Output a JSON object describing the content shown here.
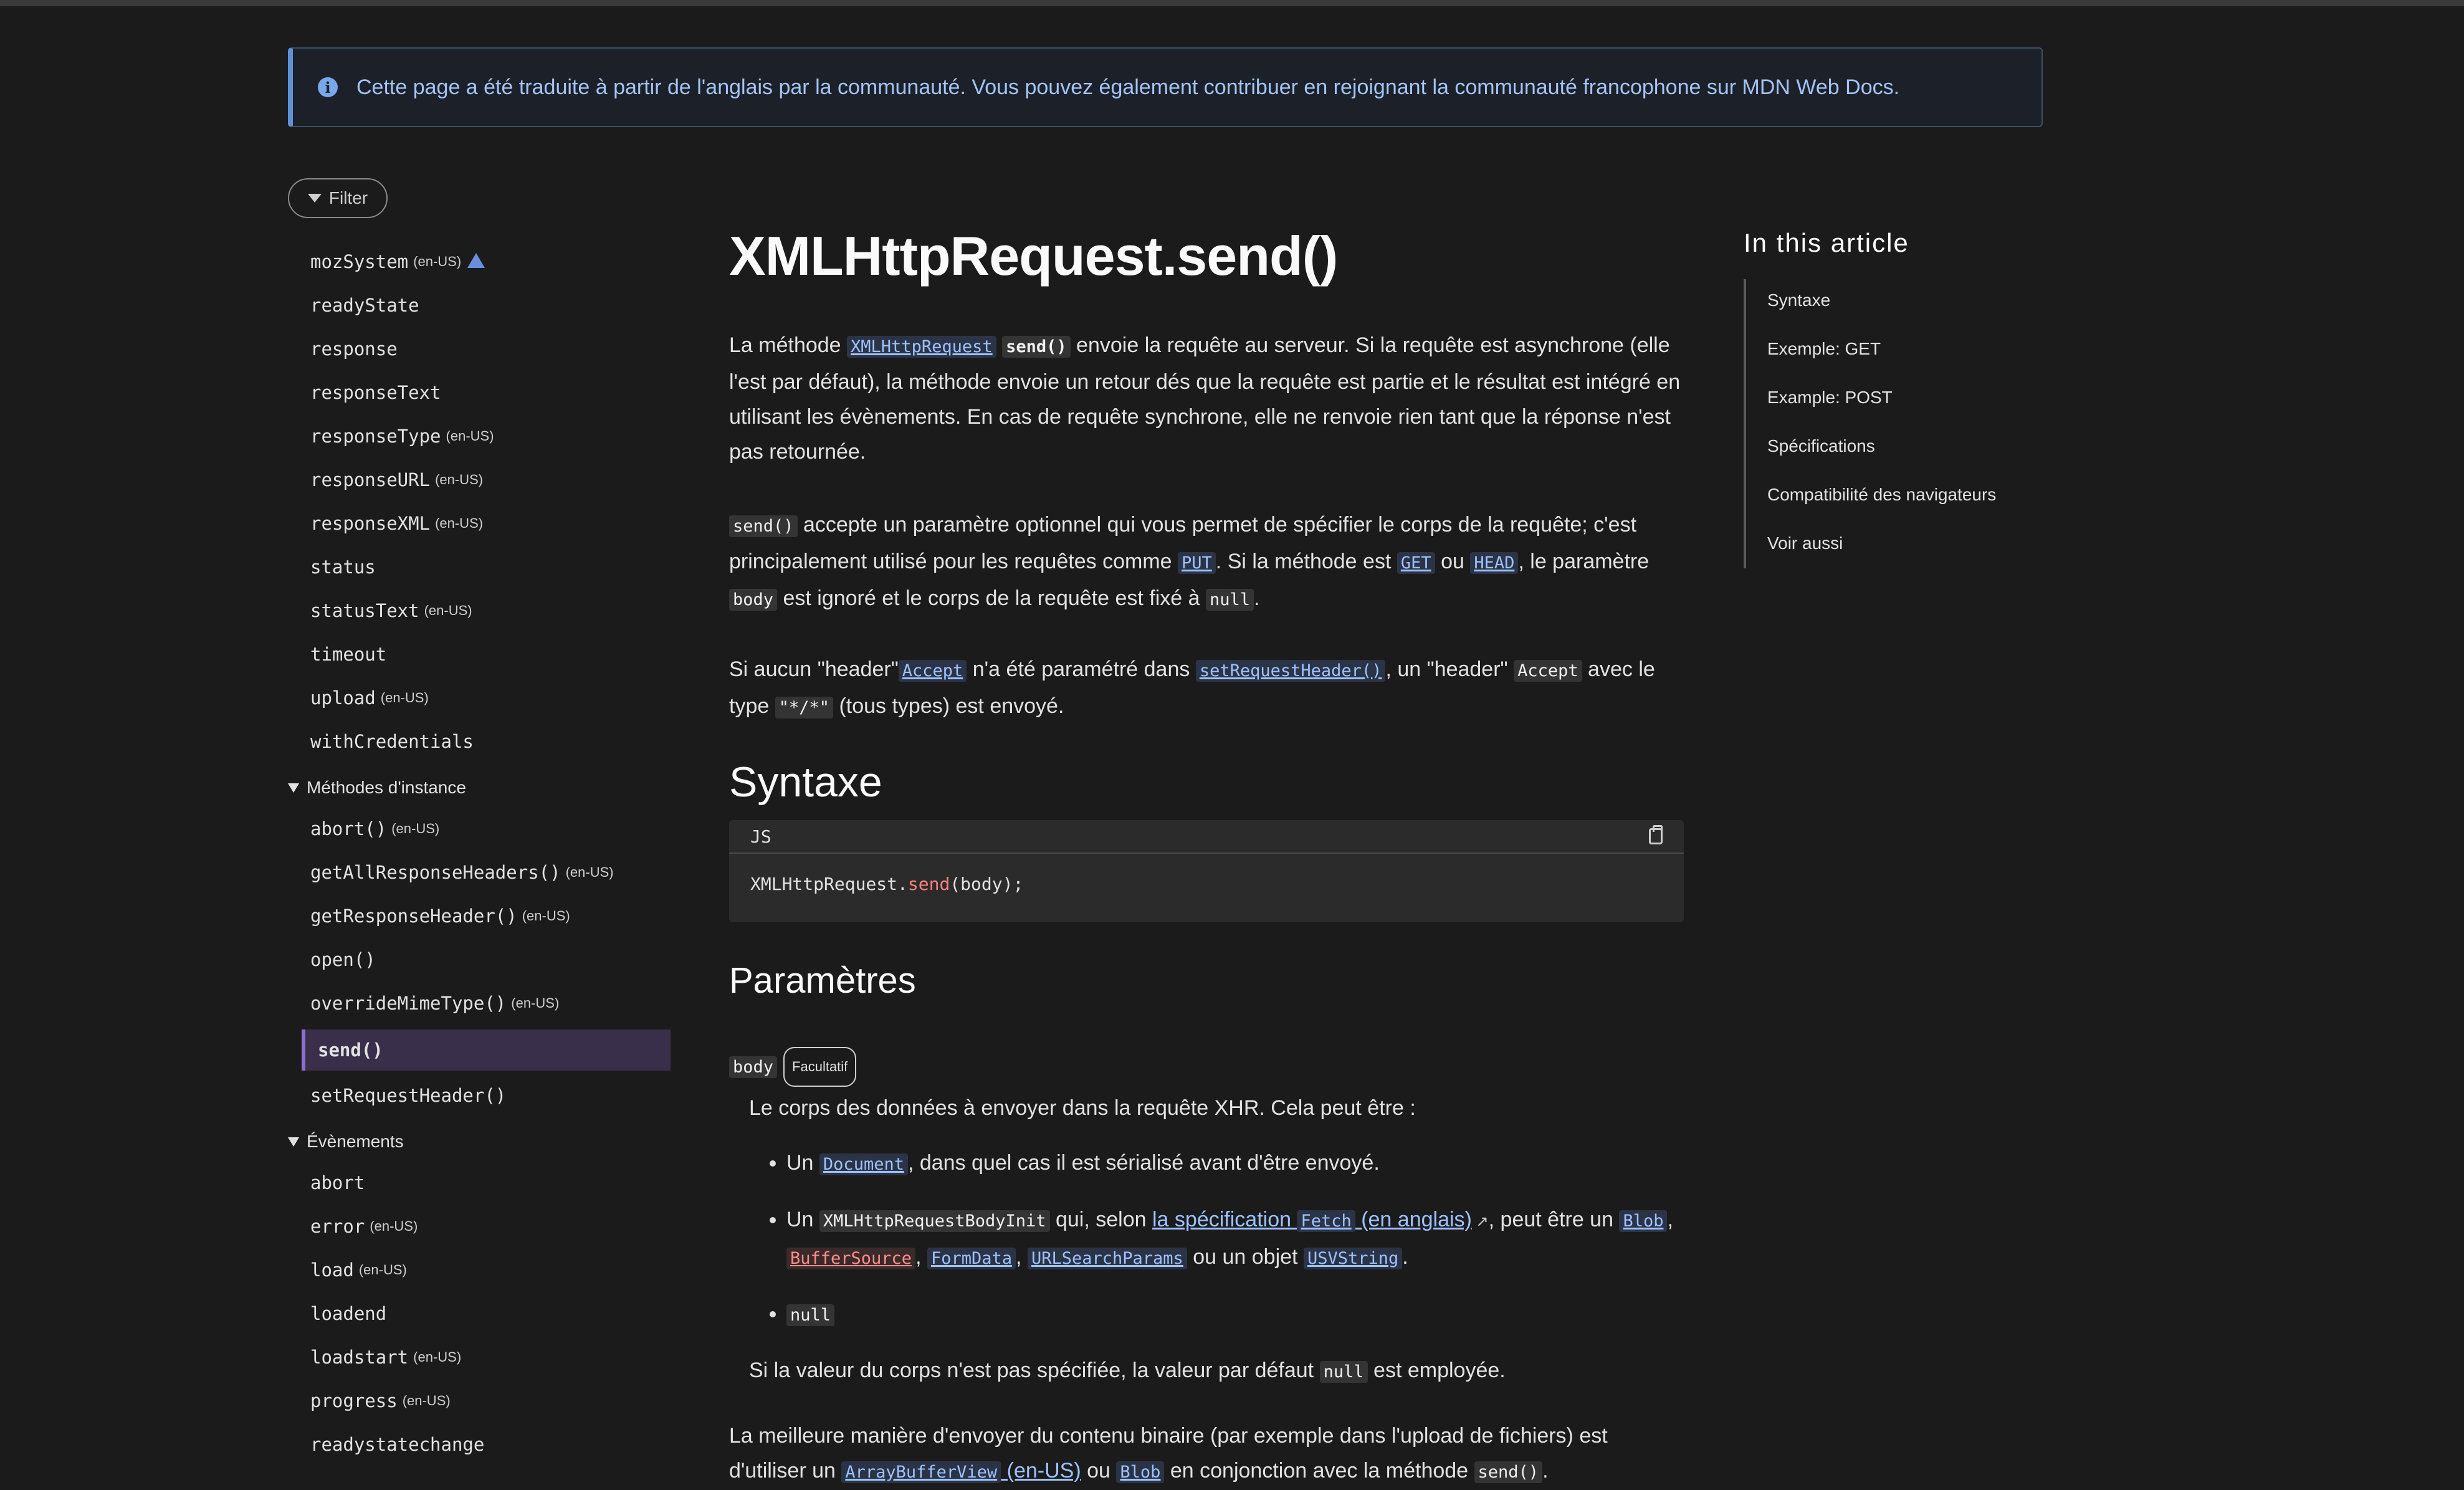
{
  "banner": {
    "text": "Cette page a été traduite à partir de l'anglais par la communauté. Vous pouvez également contribuer en rejoignant la communauté francophone sur MDN Web Docs."
  },
  "sidebar": {
    "filter_label": "Filter",
    "items": [
      {
        "label": "mozSystem",
        "en": "(en-US)",
        "warn": true
      },
      {
        "label": "readyState"
      },
      {
        "label": "response"
      },
      {
        "label": "responseText"
      },
      {
        "label": "responseType",
        "en": "(en-US)"
      },
      {
        "label": "responseURL",
        "en": "(en-US)"
      },
      {
        "label": "responseXML",
        "en": "(en-US)"
      },
      {
        "label": "status"
      },
      {
        "label": "statusText",
        "en": "(en-US)"
      },
      {
        "label": "timeout"
      },
      {
        "label": "upload",
        "en": "(en-US)"
      },
      {
        "label": "withCredentials"
      }
    ],
    "group_methods": "Méthodes d'instance",
    "methods": [
      {
        "label": "abort()",
        "en": "(en-US)"
      },
      {
        "label": "getAllResponseHeaders()",
        "en": "(en-US)"
      },
      {
        "label": "getResponseHeader()",
        "en": "(en-US)"
      },
      {
        "label": "open()"
      },
      {
        "label": "overrideMimeType()",
        "en": "(en-US)"
      },
      {
        "label": "send()",
        "active": true
      },
      {
        "label": "setRequestHeader()"
      }
    ],
    "group_events": "Évènements",
    "events": [
      {
        "label": "abort"
      },
      {
        "label": "error",
        "en": "(en-US)"
      },
      {
        "label": "load",
        "en": "(en-US)"
      },
      {
        "label": "loadend"
      },
      {
        "label": "loadstart",
        "en": "(en-US)"
      },
      {
        "label": "progress",
        "en": "(en-US)"
      },
      {
        "label": "readystatechange"
      }
    ]
  },
  "article": {
    "title": "XMLHttpRequest.send()",
    "p1": {
      "a": "La méthode ",
      "link1": "XMLHttpRequest",
      "code1": "send()",
      "b": " envoie la requête au serveur. Si la requête est asynchrone (elle l'est par défaut), la méthode envoie un retour dés que la requête est partie et le résultat est intégré en utilisant les évènements. En cas de requête synchrone, elle ne renvoie rien tant que la réponse n'est pas retournée."
    },
    "p2": {
      "code1": "send()",
      "a": " accepte un paramètre optionnel qui vous permet de spécifier le corps de la requête; c'est principalement utilisé pour les requêtes comme ",
      "link_put": "PUT",
      "b": ". Si la méthode est ",
      "link_get": "GET",
      "c": " ou ",
      "link_head": "HEAD",
      "d": ", le paramètre ",
      "code_body": "body",
      "e": " est ignoré et le corps de la requête est fixé à ",
      "code_null": "null",
      "f": "."
    },
    "p3": {
      "a": "Si aucun \"header\"",
      "link_accept": "Accept",
      "b": " n'a été paramétré dans ",
      "link_setrh": "setRequestHeader()",
      "c": ", un \"header\" ",
      "code_accept": "Accept",
      "d": " avec le type ",
      "code_type": "\"*/*\"",
      "e": " (tous types) est envoyé."
    },
    "h_syntax": "Syntaxe",
    "code_lang": "JS",
    "code_obj": "XMLHttpRequest.",
    "code_method": "send",
    "code_args": "(body);",
    "h_params": "Paramètres",
    "param_name": "body",
    "param_badge": "Facultatif",
    "param_desc": "Le corps des données à envoyer dans la requête XHR. Cela peut être :",
    "li1": {
      "a": "Un ",
      "link": "Document",
      "b": ", dans quel cas il est sérialisé avant d'être envoyé."
    },
    "li2": {
      "a": "Un ",
      "code": "XMLHttpRequestBodyInit",
      "b": " qui, selon ",
      "link_spec_a": "la spécification ",
      "link_spec_code": "Fetch",
      "link_spec_b": " (en anglais)",
      "c": ", peut être un ",
      "link_blob": "Blob",
      "sep1": ", ",
      "link_bufsrc": "BufferSource",
      "sep2": ", ",
      "link_formdata": "FormData",
      "sep3": ", ",
      "link_usp": "URLSearchParams",
      "d": " ou un objet ",
      "link_usv": "USVString",
      "e": "."
    },
    "li3_code": "null",
    "default_note": {
      "a": "Si la valeur du corps n'est pas spécifiée, la valeur par défaut ",
      "code": "null",
      "b": " est employée."
    },
    "p_last": {
      "a": "La meilleure manière d'envoyer du contenu binaire (par exemple dans l'upload de fichiers) est d'utiliser un ",
      "link_abv": "ArrayBufferView",
      "link_abv_en": " (en-US)",
      "b": " ou ",
      "link_blob": "Blob",
      "c": " en conjonction avec la méthode ",
      "code_send": "send()",
      "d": "."
    }
  },
  "toc": {
    "title": "In this article",
    "items": [
      "Syntaxe",
      "Exemple: GET",
      "Example: POST",
      "Spécifications",
      "Compatibilité des navigateurs",
      "Voir aussi"
    ]
  }
}
